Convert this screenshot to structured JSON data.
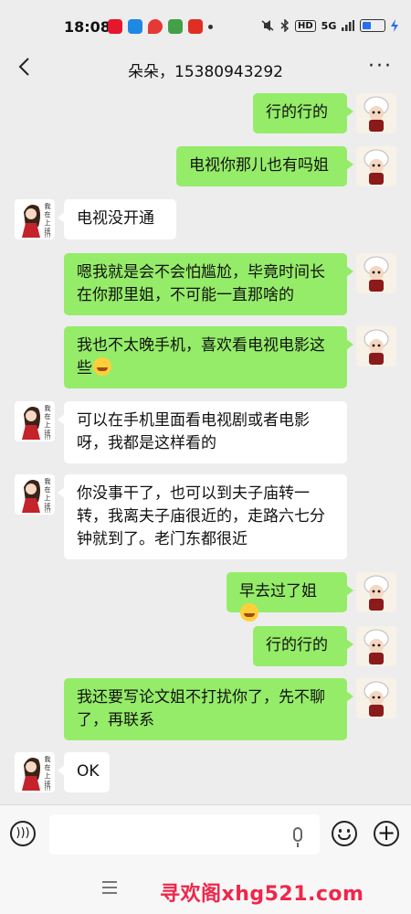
{
  "status_bar": {
    "time": "18:08",
    "signal_label": "5G",
    "hd_label": "HD"
  },
  "header": {
    "title": "朵朵，15380943292",
    "back_icon": "back-chevron-icon",
    "more_icon": "more-dots-icon"
  },
  "messages": [
    {
      "sender": "me",
      "text": "行的行的"
    },
    {
      "sender": "me",
      "text": "电视你那儿也有吗姐"
    },
    {
      "sender": "them",
      "text": "电视没开通"
    },
    {
      "sender": "me",
      "text": "嗯我就是会不会怕尴尬，毕竟时间长在你那里姐，不可能一直那啥的"
    },
    {
      "sender": "me",
      "text": "我也不太晚手机，喜欢看电视电影这些",
      "emoji": "laugh-cry-emoji"
    },
    {
      "sender": "them",
      "text": "可以在手机里面看电视剧或者电影呀，我都是这样看的"
    },
    {
      "sender": "them",
      "text": "你没事干了，也可以到夫子庙转一转，我离夫子庙很近的，走路六七分钟就到了。老门东都很近"
    },
    {
      "sender": "me",
      "text": "早去过了姐",
      "emoji": "laugh-cry-emoji"
    },
    {
      "sender": "me",
      "text": "行的行的"
    },
    {
      "sender": "me",
      "text": "我还要写论文姐不打扰你了，先不聊了，再联系"
    },
    {
      "sender": "them",
      "text": "OK"
    }
  ],
  "avatar_them_text": "我在上班!!!",
  "input_bar": {
    "placeholder": ""
  },
  "nav": {
    "watermark": "寻欢阁xhg521.com"
  },
  "colors": {
    "my_bubble": "#95ec69",
    "their_bubble": "#ffffff",
    "background": "#ededed",
    "watermark": "#f0264a"
  }
}
